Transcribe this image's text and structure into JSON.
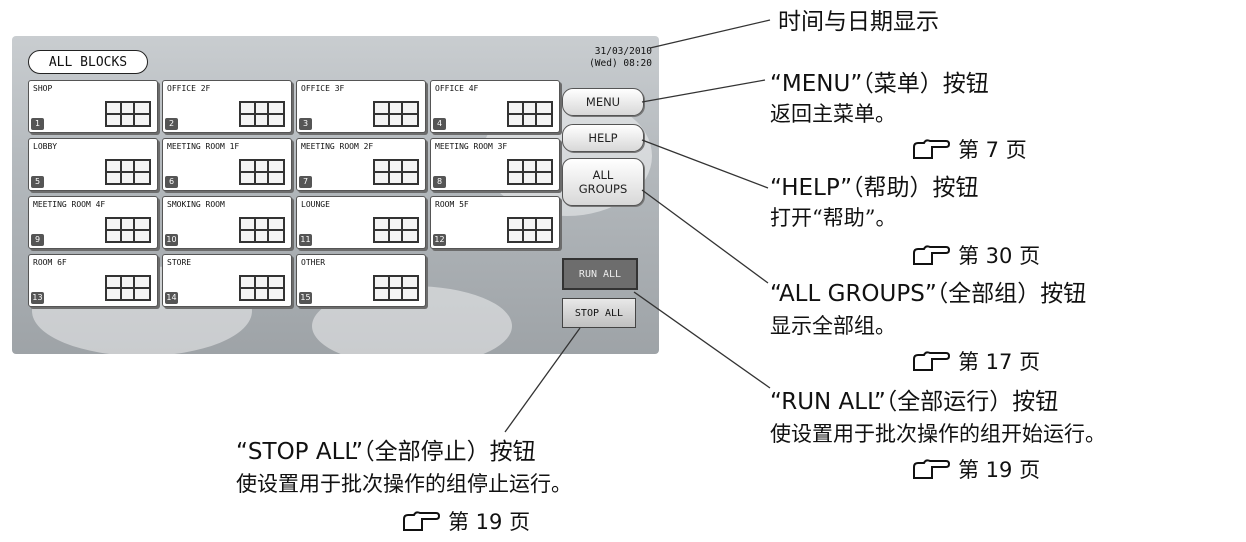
{
  "screen": {
    "header_button": "ALL BLOCKS",
    "date": "31/03/2010",
    "time": "(Wed) 08:20",
    "blocks": [
      {
        "name": "SHOP",
        "num": "1"
      },
      {
        "name": "OFFICE 2F",
        "num": "2"
      },
      {
        "name": "OFFICE 3F",
        "num": "3"
      },
      {
        "name": "OFFICE 4F",
        "num": "4"
      },
      {
        "name": "LOBBY",
        "num": "5"
      },
      {
        "name": "MEETING ROOM 1F",
        "num": "6"
      },
      {
        "name": "MEETING ROOM 2F",
        "num": "7"
      },
      {
        "name": "MEETING ROOM 3F",
        "num": "8"
      },
      {
        "name": "MEETING ROOM 4F",
        "num": "9"
      },
      {
        "name": "SMOKING ROOM",
        "num": "10"
      },
      {
        "name": "LOUNGE",
        "num": "11"
      },
      {
        "name": "ROOM 5F",
        "num": "12"
      },
      {
        "name": "ROOM 6F",
        "num": "13"
      },
      {
        "name": "STORE",
        "num": "14"
      },
      {
        "name": "OTHER",
        "num": "15"
      }
    ],
    "menu_label": "MENU",
    "help_label": "HELP",
    "groups_label_1": "ALL",
    "groups_label_2": "GROUPS",
    "run_all_label": "RUN ALL",
    "stop_all_label": "STOP ALL"
  },
  "annotations": {
    "datetime_title": "时间与日期显示",
    "menu_title": "“MENU”（菜单）按钮",
    "menu_desc": "返回主菜单。",
    "menu_page": "第 7 页",
    "help_title": "“HELP”（帮助）按钮",
    "help_desc": "打开“帮助”。",
    "help_page": "第 30 页",
    "groups_title": "“ALL GROUPS”（全部组）按钮",
    "groups_desc": "显示全部组。",
    "groups_page": "第 17 页",
    "run_title": "“RUN ALL”（全部运行）按钮",
    "run_desc": "使设置用于批次操作的组开始运行。",
    "run_page": "第 19 页",
    "stop_title": "“STOP ALL”（全部停止）按钮",
    "stop_desc": "使设置用于批次操作的组停止运行。",
    "stop_page": "第 19 页"
  }
}
